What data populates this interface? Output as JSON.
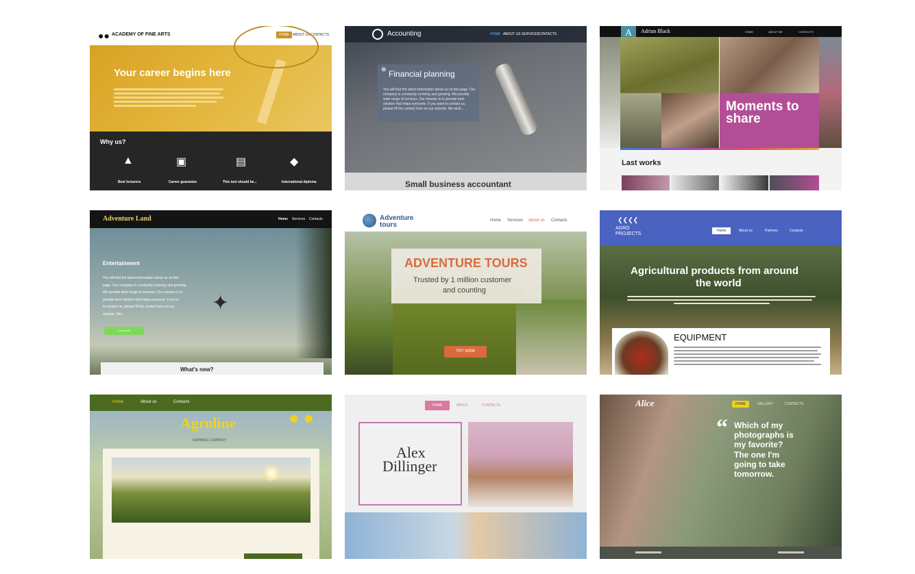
{
  "cards": [
    {
      "logo": "ACADEMY OF FINE ARTS",
      "nav": [
        "HOME",
        "ABOUT US",
        "CONTACTS"
      ],
      "headline": "Your career begins here",
      "section_title": "Why us?",
      "features": [
        "Best lecturers",
        "Career guarantee",
        "This text should be...",
        "International diploma"
      ]
    },
    {
      "logo": "Accounting",
      "nav": [
        "HOME",
        "ABOUT US",
        "SERVICES",
        "CONTACTS"
      ],
      "headline": "Financial planning",
      "body": "You will find the latest information about us on this page. Our company is constantly evolving and growing. We provide wide range of services. Our mission is to provide best solution that helps everyone. If you want to contact us, please fill the contact form on our website. We wish...",
      "footer_title": "Small business accountant"
    },
    {
      "logo_letter": "A",
      "logo": "Adrian Black",
      "nav": [
        "HOME",
        "ABOUT ME",
        "CONTACTS"
      ],
      "headline_line1": "Moments to",
      "headline_line2": "share",
      "section_title": "Last works"
    },
    {
      "logo": "Adventure Land",
      "nav": [
        "Home",
        "Services",
        "Contacts"
      ],
      "section_title": "Entertainment",
      "body_lines": [
        "You will find the latest information about us on this",
        "page. Our company is constantly evolving and growing.",
        "We provide wide range of services. Our mission is to",
        "provide best solution that helps everyone. If you w",
        "to contact us, please fill the contact form on our",
        "website. We..."
      ],
      "button": "Look for it!",
      "news_title": "What's new?"
    },
    {
      "logo_line1": "Adventure",
      "logo_line2": "tours",
      "nav": [
        "Home",
        "Services",
        "About us",
        "Contacts"
      ],
      "headline": "ADVENTURE TOURS",
      "sub_line1": "Trusted by 1 million customer",
      "sub_line2": "and counting",
      "button": "TRY NOW"
    },
    {
      "logo_line1": "AGRO",
      "logo_line2": "PROJECTS",
      "nav": [
        "Home",
        "About us",
        "Partners",
        "Contacts"
      ],
      "headline_line1": "Agricultural products from around",
      "headline_line2": "the world",
      "section_title": "EQUIPMENT"
    },
    {
      "nav": [
        "Home",
        "About us",
        "Contacts"
      ],
      "logo": "Agroline",
      "tagline": "FARMING COMPANY"
    },
    {
      "nav": [
        "HOME",
        "ABOUT",
        "CONTACTS"
      ],
      "name_line1": "Alex",
      "name_line2": "Dillinger"
    },
    {
      "logo": "Alice",
      "nav": [
        "HOME",
        "GALLERY",
        "CONTACTS"
      ],
      "quote_lines": [
        "Which of my",
        "photographs is",
        "my favorite?",
        "The one I'm",
        "going to take",
        "tomorrow."
      ]
    }
  ],
  "colors": {
    "academy_yellow": "#d9a62a",
    "adventure_land_green": "#7ed957",
    "adventure_tours_orange": "#d86b3c",
    "agro_blue": "#4a63c1",
    "agroline_green": "#4c6a1f",
    "agroline_yellow": "#ecd223",
    "alex_pink": "#d9799e",
    "alice_yellow": "#f0d01c"
  }
}
